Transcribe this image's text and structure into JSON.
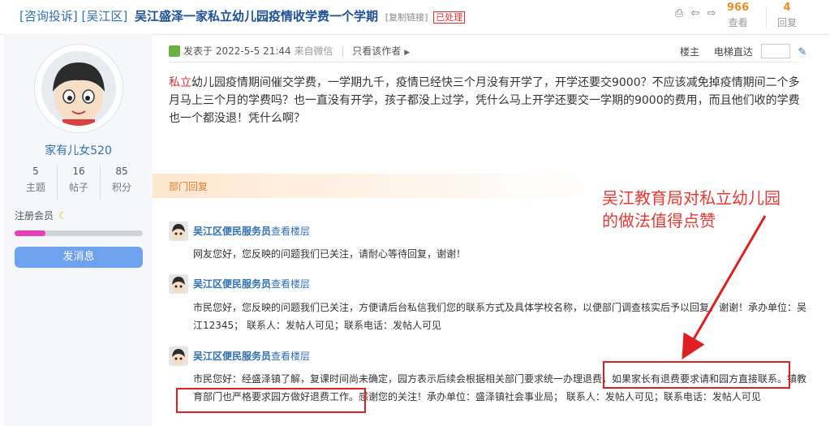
{
  "header": {
    "category1": "[咨询投诉]",
    "category2": "[吴江区]",
    "title": "吴江盛泽一家私立幼儿园疫情收学费一个学期",
    "copy_link": "[复制链接]",
    "status": "已处理",
    "views_count": "966",
    "views_label": "查看",
    "replies_count": "4",
    "replies_label": "回复",
    "icons": [
      "print-icon",
      "arrow-left-icon",
      "arrow-right-icon"
    ]
  },
  "user": {
    "name": "家有儿女520",
    "stats": [
      {
        "value": "5",
        "label": "主题"
      },
      {
        "value": "16",
        "label": "帖子"
      },
      {
        "value": "85",
        "label": "积分"
      }
    ],
    "member_level": "注册会员",
    "progress": 0.24,
    "message_button": "发消息"
  },
  "post": {
    "meta_posted": "发表于 2022-5-5 21:44",
    "meta_source": "来自微信",
    "meta_author_only": "只看该作者",
    "floor_label": "楼主",
    "jump_label": "电梯直达",
    "keyword": "私立",
    "text": "幼儿园疫情期间催交学费，一学期九千，疫情已经快三个月没有开学了，开学还要交9000？不应该减免掉疫情期间二个多月马上三个月的学费吗？也一直没有开学，孩子都没上过学，凭什么马上开学还要交一学期的9000的费用，而且他们收的学费也一个都没退！凭什么啊？"
  },
  "department": {
    "label": "部门回复",
    "replies": [
      {
        "name": "吴江区便民服务员",
        "view": "查看楼层",
        "text": "网友您好，您反映的问题我们已关注，请耐心等待回复，谢谢！"
      },
      {
        "name": "吴江区便民服务员",
        "view": "查看楼层",
        "text": "市民您好，您反映的问题我们已关注，方便请后台私信我们您的联系方式及具体学校名称，以便部门调查核实后予以回复，谢谢！承办单位：吴江12345； 联系人：发帖人可见；联系电话：发帖人可见"
      },
      {
        "name": "吴江区便民服务员",
        "view": "查看楼层",
        "text": "市民您好：经盛泽镇了解，复课时间尚未确定，园方表示后续会根据相关部门要求统一办理退费，如果家长有退费要求请和园方直接联系。镇教育部门也严格要求园方做好退费工作。感谢您的关注！承办单位：盛泽镇社会事业局； 联系人：发帖人可见；联系电话：发帖人可见"
      }
    ]
  },
  "annotation": {
    "text": "吴江教育局对私立幼儿园的做法值得点赞",
    "color": "#e53935"
  }
}
